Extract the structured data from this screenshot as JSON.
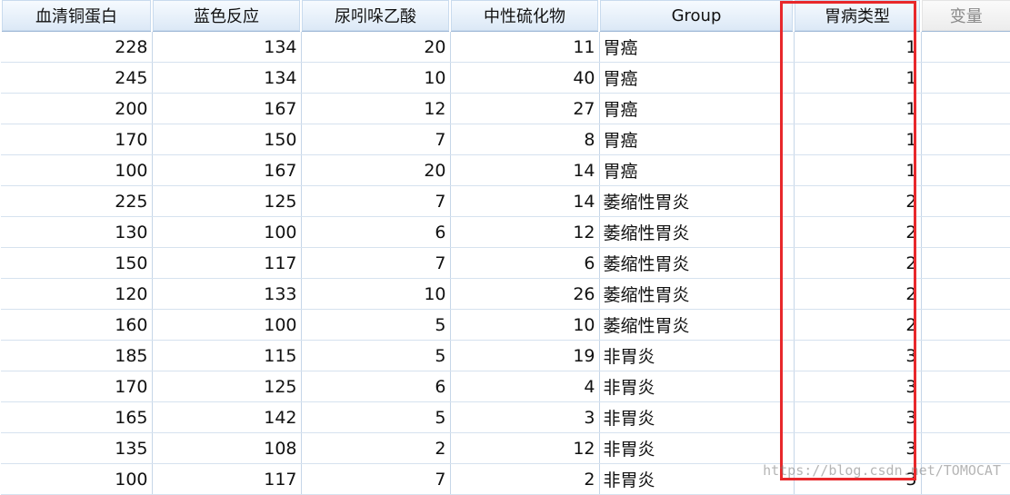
{
  "columns": [
    "血清铜蛋白",
    "蓝色反应",
    "尿吲哚乙酸",
    "中性硫化物",
    "Group",
    "胃病类型",
    "变量"
  ],
  "rows": [
    [
      "228",
      "134",
      "20",
      "11",
      "胃癌",
      "1"
    ],
    [
      "245",
      "134",
      "10",
      "40",
      "胃癌",
      "1"
    ],
    [
      "200",
      "167",
      "12",
      "27",
      "胃癌",
      "1"
    ],
    [
      "170",
      "150",
      "7",
      "8",
      "胃癌",
      "1"
    ],
    [
      "100",
      "167",
      "20",
      "14",
      "胃癌",
      "1"
    ],
    [
      "225",
      "125",
      "7",
      "14",
      "萎缩性胃炎",
      "2"
    ],
    [
      "130",
      "100",
      "6",
      "12",
      "萎缩性胃炎",
      "2"
    ],
    [
      "150",
      "117",
      "7",
      "6",
      "萎缩性胃炎",
      "2"
    ],
    [
      "120",
      "133",
      "10",
      "26",
      "萎缩性胃炎",
      "2"
    ],
    [
      "160",
      "100",
      "5",
      "10",
      "萎缩性胃炎",
      "2"
    ],
    [
      "185",
      "115",
      "5",
      "19",
      "非胃炎",
      "3"
    ],
    [
      "170",
      "125",
      "6",
      "4",
      "非胃炎",
      "3"
    ],
    [
      "165",
      "142",
      "5",
      "3",
      "非胃炎",
      "3"
    ],
    [
      "135",
      "108",
      "2",
      "12",
      "非胃炎",
      "3"
    ],
    [
      "100",
      "117",
      "7",
      "2",
      "非胃炎",
      "3"
    ]
  ],
  "watermark": "https://blog.csdn.net/TOMOCAT",
  "colors": {
    "highlight": "#e8282b",
    "header_bg": "#dbe8f6"
  }
}
